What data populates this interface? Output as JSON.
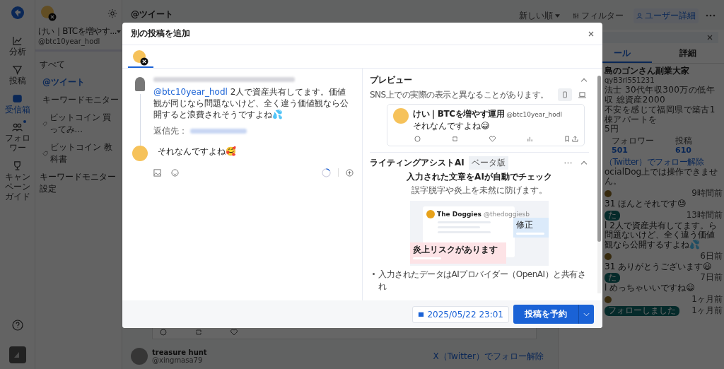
{
  "rail": {
    "items": [
      {
        "label": "分析",
        "selected": false,
        "dot": false
      },
      {
        "label": "投稿",
        "selected": false,
        "dot": false
      },
      {
        "label": "受信箱",
        "selected": true,
        "dot": false
      },
      {
        "label": "フォロワー",
        "selected": false,
        "dot": true
      },
      {
        "label": "キャンペーンガイド",
        "selected": false,
        "dot": false
      }
    ]
  },
  "sidebar": {
    "account_name": "けい｜BTCを増やす...",
    "handle": "@btc10year_hodl",
    "items": [
      {
        "label": "すべて",
        "selected": false,
        "kind": "section"
      },
      {
        "label": "@ツイート",
        "selected": true,
        "kind": "item"
      },
      {
        "label": "キーワードモニター",
        "selected": false,
        "kind": "item"
      },
      {
        "label": "ビットコイン 買ってみ...",
        "selected": false,
        "kind": "tag"
      },
      {
        "label": "ビットコイン 教科書",
        "selected": false,
        "kind": "tag"
      },
      {
        "label": "キーワードモニター設定",
        "selected": false,
        "kind": "section"
      }
    ]
  },
  "main": {
    "title": "@ツイート",
    "toolbar": {
      "sort": "新しい順",
      "filter": "フィルター",
      "user_details": "ユーザー詳細"
    },
    "feed_tweet": {
      "name": "treasure hunt",
      "handle": "@xingmasa79",
      "unfollow_link": "X（Twitter）でフォロー解除"
    }
  },
  "user_panel": {
    "tabs": [
      {
        "label": "ール",
        "selected": true
      },
      {
        "label": "詳細",
        "selected": false
      }
    ],
    "name": "島のゴンさん副業大家",
    "handle": "qyB3rl551231",
    "bio": [
      "法士 30代年収300万の低年収 総資産2000",
      "不安を感じて福岡県で築古1棟アパートを",
      "5円"
    ],
    "stats": [
      {
        "label": "フォロワー",
        "value": "501"
      },
      {
        "label": "投稿",
        "value": "610"
      }
    ],
    "unfollow_link": "（Twitter）でフォロー解除",
    "note": "ocialDog上では操作できません。",
    "activity": [
      {
        "time": "9時間前",
        "text": "31 ほんとそれです😓"
      },
      {
        "tag": "た",
        "time": "13時間前",
        "text": "l 2人で資産共有してます。ら問題ないけど、全く違う価値観なら公開するすよね💦"
      },
      {
        "time": "6日前",
        "text": "31 ありがとうございます😃"
      },
      {
        "tag": "た",
        "time": "7日前",
        "text": "l めっちゃいいですね😄"
      },
      {
        "time": "1ヶ月前"
      },
      {
        "tag": "フォローしました",
        "time": "1ヶ月前"
      }
    ]
  },
  "modal": {
    "title": "別の投稿を追加",
    "account_tabs": [
      {
        "selected": true
      }
    ],
    "original_tweet": {
      "mention": "@btc10year_hodl",
      "text": " 2人で資産共有してます。価値観が同じなら問題ないけど、全く違う価値観なら公開すると浪費されそうですよね💦",
      "reply_to_label": "返信先："
    },
    "reply_text": "それなんですよね🥰",
    "preview": {
      "title": "プレビュー",
      "note": "SNS上での実際の表示と異なることがあります。",
      "devices": [
        {
          "kind": "mobile",
          "selected": true
        },
        {
          "kind": "desktop",
          "selected": false
        }
      ],
      "name": "けい｜BTCを増やす運用",
      "handle": "@btc10year_hodl",
      "text": "それなんですよね😅"
    },
    "assist": {
      "title": "ライティングアシストAI",
      "badge": "ベータ版",
      "headline": "入力された文章をAIが自動でチェック",
      "subline": "誤字脱字や炎上を未然に防げます。",
      "illustration": {
        "account": "The Doggies",
        "handle": "@thedoggiesb",
        "fix_label": "修正",
        "risk_label": "炎上リスクがあります"
      },
      "bullets": [
        "入力されたデータはAIプロバイダー（OpenAI）と共有され"
      ]
    },
    "schedule_date": "2025/05/22 23:01",
    "submit": "投稿を予約"
  }
}
